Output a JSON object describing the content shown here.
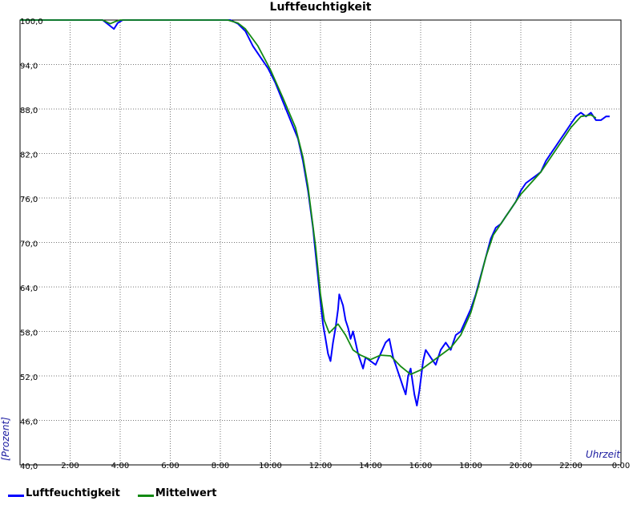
{
  "chart_data": {
    "type": "line",
    "title": "Luftfeuchtigkeit",
    "xlabel": "Uhrzeit",
    "ylabel": "[Prozent]",
    "xlim": [
      0,
      24
    ],
    "ylim": [
      40,
      100
    ],
    "x_ticks": [
      "",
      "2:00",
      "4:00",
      "6:00",
      "8:00",
      "10:00",
      "12:00",
      "14:00",
      "16:00",
      "18:00",
      "20:00",
      "22:00",
      "0:00"
    ],
    "y_ticks": [
      "40,0",
      "46,0",
      "52,0",
      "58,0",
      "64,0",
      "70,0",
      "76,0",
      "82,0",
      "88,0",
      "94,0",
      "100,0"
    ],
    "grid": true,
    "legend_position": "bottom-left",
    "series": [
      {
        "name": "Luftfeuchtigkeit",
        "color": "#0000ff",
        "points": [
          [
            0.0,
            100
          ],
          [
            3.3,
            100
          ],
          [
            3.6,
            99.2
          ],
          [
            3.75,
            98.8
          ],
          [
            3.9,
            99.6
          ],
          [
            4.1,
            100
          ],
          [
            8.4,
            100
          ],
          [
            8.7,
            99.5
          ],
          [
            9.0,
            98.5
          ],
          [
            9.3,
            96.5
          ],
          [
            9.6,
            95.0
          ],
          [
            9.9,
            93.5
          ],
          [
            10.2,
            91.5
          ],
          [
            10.5,
            89.0
          ],
          [
            10.8,
            86.5
          ],
          [
            11.1,
            84.0
          ],
          [
            11.3,
            81.0
          ],
          [
            11.5,
            77.0
          ],
          [
            11.7,
            72.0
          ],
          [
            11.85,
            67.0
          ],
          [
            12.0,
            62.0
          ],
          [
            12.1,
            59.0
          ],
          [
            12.2,
            57.0
          ],
          [
            12.3,
            55.0
          ],
          [
            12.4,
            54.0
          ],
          [
            12.5,
            56.5
          ],
          [
            12.6,
            58.5
          ],
          [
            12.7,
            61.0
          ],
          [
            12.75,
            63.0
          ],
          [
            12.9,
            61.5
          ],
          [
            13.0,
            59.5
          ],
          [
            13.1,
            58.5
          ],
          [
            13.2,
            57.0
          ],
          [
            13.3,
            58.0
          ],
          [
            13.4,
            56.5
          ],
          [
            13.5,
            55.0
          ],
          [
            13.6,
            54.0
          ],
          [
            13.7,
            53.0
          ],
          [
            13.8,
            54.5
          ],
          [
            14.0,
            54.0
          ],
          [
            14.2,
            53.5
          ],
          [
            14.4,
            55.0
          ],
          [
            14.6,
            56.5
          ],
          [
            14.75,
            57.0
          ],
          [
            14.9,
            54.5
          ],
          [
            15.0,
            53.5
          ],
          [
            15.1,
            52.5
          ],
          [
            15.2,
            51.5
          ],
          [
            15.3,
            50.5
          ],
          [
            15.4,
            49.5
          ],
          [
            15.5,
            52.0
          ],
          [
            15.6,
            53.0
          ],
          [
            15.75,
            49.5
          ],
          [
            15.85,
            48.0
          ],
          [
            15.95,
            50.0
          ],
          [
            16.1,
            54.0
          ],
          [
            16.2,
            55.5
          ],
          [
            16.4,
            54.5
          ],
          [
            16.6,
            53.5
          ],
          [
            16.8,
            55.5
          ],
          [
            17.0,
            56.5
          ],
          [
            17.2,
            55.5
          ],
          [
            17.4,
            57.5
          ],
          [
            17.6,
            58.0
          ],
          [
            17.8,
            59.5
          ],
          [
            18.0,
            61.0
          ],
          [
            18.2,
            63.0
          ],
          [
            18.4,
            65.5
          ],
          [
            18.6,
            68.0
          ],
          [
            18.8,
            70.5
          ],
          [
            19.0,
            72.0
          ],
          [
            19.2,
            72.5
          ],
          [
            19.4,
            73.5
          ],
          [
            19.6,
            74.5
          ],
          [
            19.8,
            75.5
          ],
          [
            20.0,
            77.0
          ],
          [
            20.2,
            78.0
          ],
          [
            20.4,
            78.5
          ],
          [
            20.6,
            79.0
          ],
          [
            20.8,
            79.5
          ],
          [
            21.0,
            81.0
          ],
          [
            21.2,
            82.0
          ],
          [
            21.4,
            83.0
          ],
          [
            21.6,
            84.0
          ],
          [
            21.8,
            85.0
          ],
          [
            22.0,
            86.0
          ],
          [
            22.2,
            87.0
          ],
          [
            22.4,
            87.5
          ],
          [
            22.6,
            87.0
          ],
          [
            22.8,
            87.5
          ],
          [
            23.0,
            86.5
          ],
          [
            23.2,
            86.5
          ],
          [
            23.4,
            87.0
          ],
          [
            23.55,
            87.0
          ]
        ]
      },
      {
        "name": "Mittelwert",
        "color": "#138a13",
        "points": [
          [
            0.0,
            100
          ],
          [
            3.3,
            100
          ],
          [
            3.6,
            99.5
          ],
          [
            3.8,
            99.8
          ],
          [
            4.0,
            100
          ],
          [
            8.3,
            100
          ],
          [
            8.7,
            99.6
          ],
          [
            9.0,
            98.8
          ],
          [
            9.5,
            96.5
          ],
          [
            10.0,
            93.3
          ],
          [
            10.5,
            89.5
          ],
          [
            11.0,
            85.5
          ],
          [
            11.3,
            81.5
          ],
          [
            11.5,
            77.5
          ],
          [
            11.8,
            69.5
          ],
          [
            12.0,
            63.0
          ],
          [
            12.15,
            59.5
          ],
          [
            12.35,
            57.8
          ],
          [
            12.7,
            59.0
          ],
          [
            13.0,
            57.5
          ],
          [
            13.3,
            55.5
          ],
          [
            13.6,
            54.8
          ],
          [
            14.0,
            54.2
          ],
          [
            14.4,
            54.8
          ],
          [
            14.8,
            54.7
          ],
          [
            15.2,
            53.3
          ],
          [
            15.6,
            52.2
          ],
          [
            16.0,
            52.8
          ],
          [
            16.4,
            53.8
          ],
          [
            16.8,
            54.8
          ],
          [
            17.2,
            55.8
          ],
          [
            17.6,
            57.5
          ],
          [
            18.0,
            60.5
          ],
          [
            18.3,
            64.0
          ],
          [
            18.6,
            68.0
          ],
          [
            18.9,
            71.0
          ],
          [
            19.2,
            72.5
          ],
          [
            19.6,
            74.5
          ],
          [
            20.0,
            76.5
          ],
          [
            20.4,
            78.0
          ],
          [
            20.8,
            79.5
          ],
          [
            21.2,
            81.5
          ],
          [
            21.6,
            83.5
          ],
          [
            22.0,
            85.5
          ],
          [
            22.4,
            87.0
          ],
          [
            22.8,
            87.2
          ],
          [
            23.0,
            86.8
          ]
        ]
      }
    ]
  },
  "legend": {
    "items": [
      "Luftfeuchtigkeit",
      "Mittelwert"
    ]
  }
}
